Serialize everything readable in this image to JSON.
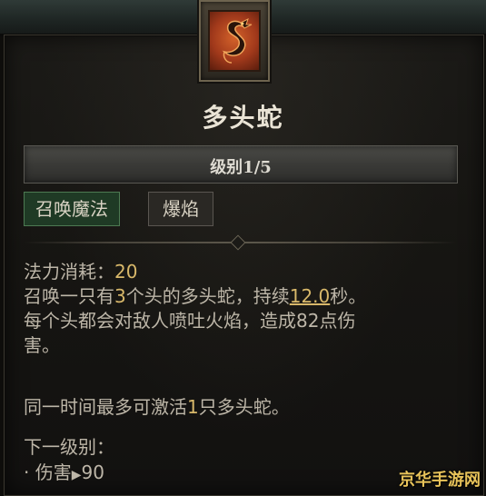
{
  "skill": {
    "name": "多头蛇",
    "rank": "级别1/5",
    "tags": [
      "召唤魔法",
      "爆焰"
    ],
    "mana_label": "法力消耗：",
    "mana_value": "20",
    "desc_1_pre": "召唤一只有",
    "desc_1_num": "3",
    "desc_1_mid": "个头的多头蛇，持续",
    "desc_1_dur": "12.0",
    "desc_1_post": "秒。",
    "desc_2": "每个头都会对敌人喷吐火焰，造成82点伤",
    "desc_3": "害。",
    "limit_pre": "同一时间最多可激活",
    "limit_num": "1",
    "limit_post": "只多头蛇。",
    "next_rank_label": "下一级别：",
    "next_rank_stat": "伤害",
    "next_rank_value": "90"
  },
  "icon": "hydra-dragon-icon",
  "watermark": "京华手游网",
  "colors": {
    "highlight": "#d8b86a",
    "school_tag": "#1f3a25"
  }
}
